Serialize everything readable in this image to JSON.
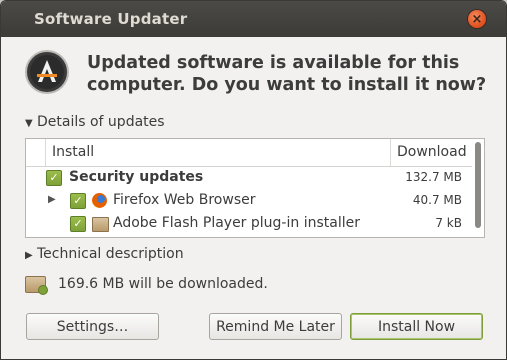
{
  "window": {
    "title": "Software Updater"
  },
  "headline": "Updated software is available for this computer. Do you want to install it now?",
  "details_expander": "Details of updates",
  "list": {
    "columns": [
      "Install",
      "Download"
    ],
    "rows": [
      {
        "label": "Security updates",
        "size": "132.7 MB",
        "checked": true,
        "bold": true,
        "icon": "none"
      },
      {
        "label": "Firefox Web Browser",
        "size": "40.7 MB",
        "checked": true,
        "bold": false,
        "icon": "firefox-icon"
      },
      {
        "label": "Adobe Flash Player plug-in installer",
        "size": "7 kB",
        "checked": true,
        "bold": false,
        "icon": "package-icon"
      }
    ]
  },
  "technical_expander": "Technical description",
  "download_summary": "169.6 MB will be downloaded.",
  "buttons": {
    "settings": "Settings…",
    "remind": "Remind Me Later",
    "install": "Install Now"
  },
  "colors": {
    "titlebar": "#3c3b37",
    "window_bg": "#f2f1f0",
    "checkbox": "#7ea238",
    "close_button": "#e25522"
  }
}
